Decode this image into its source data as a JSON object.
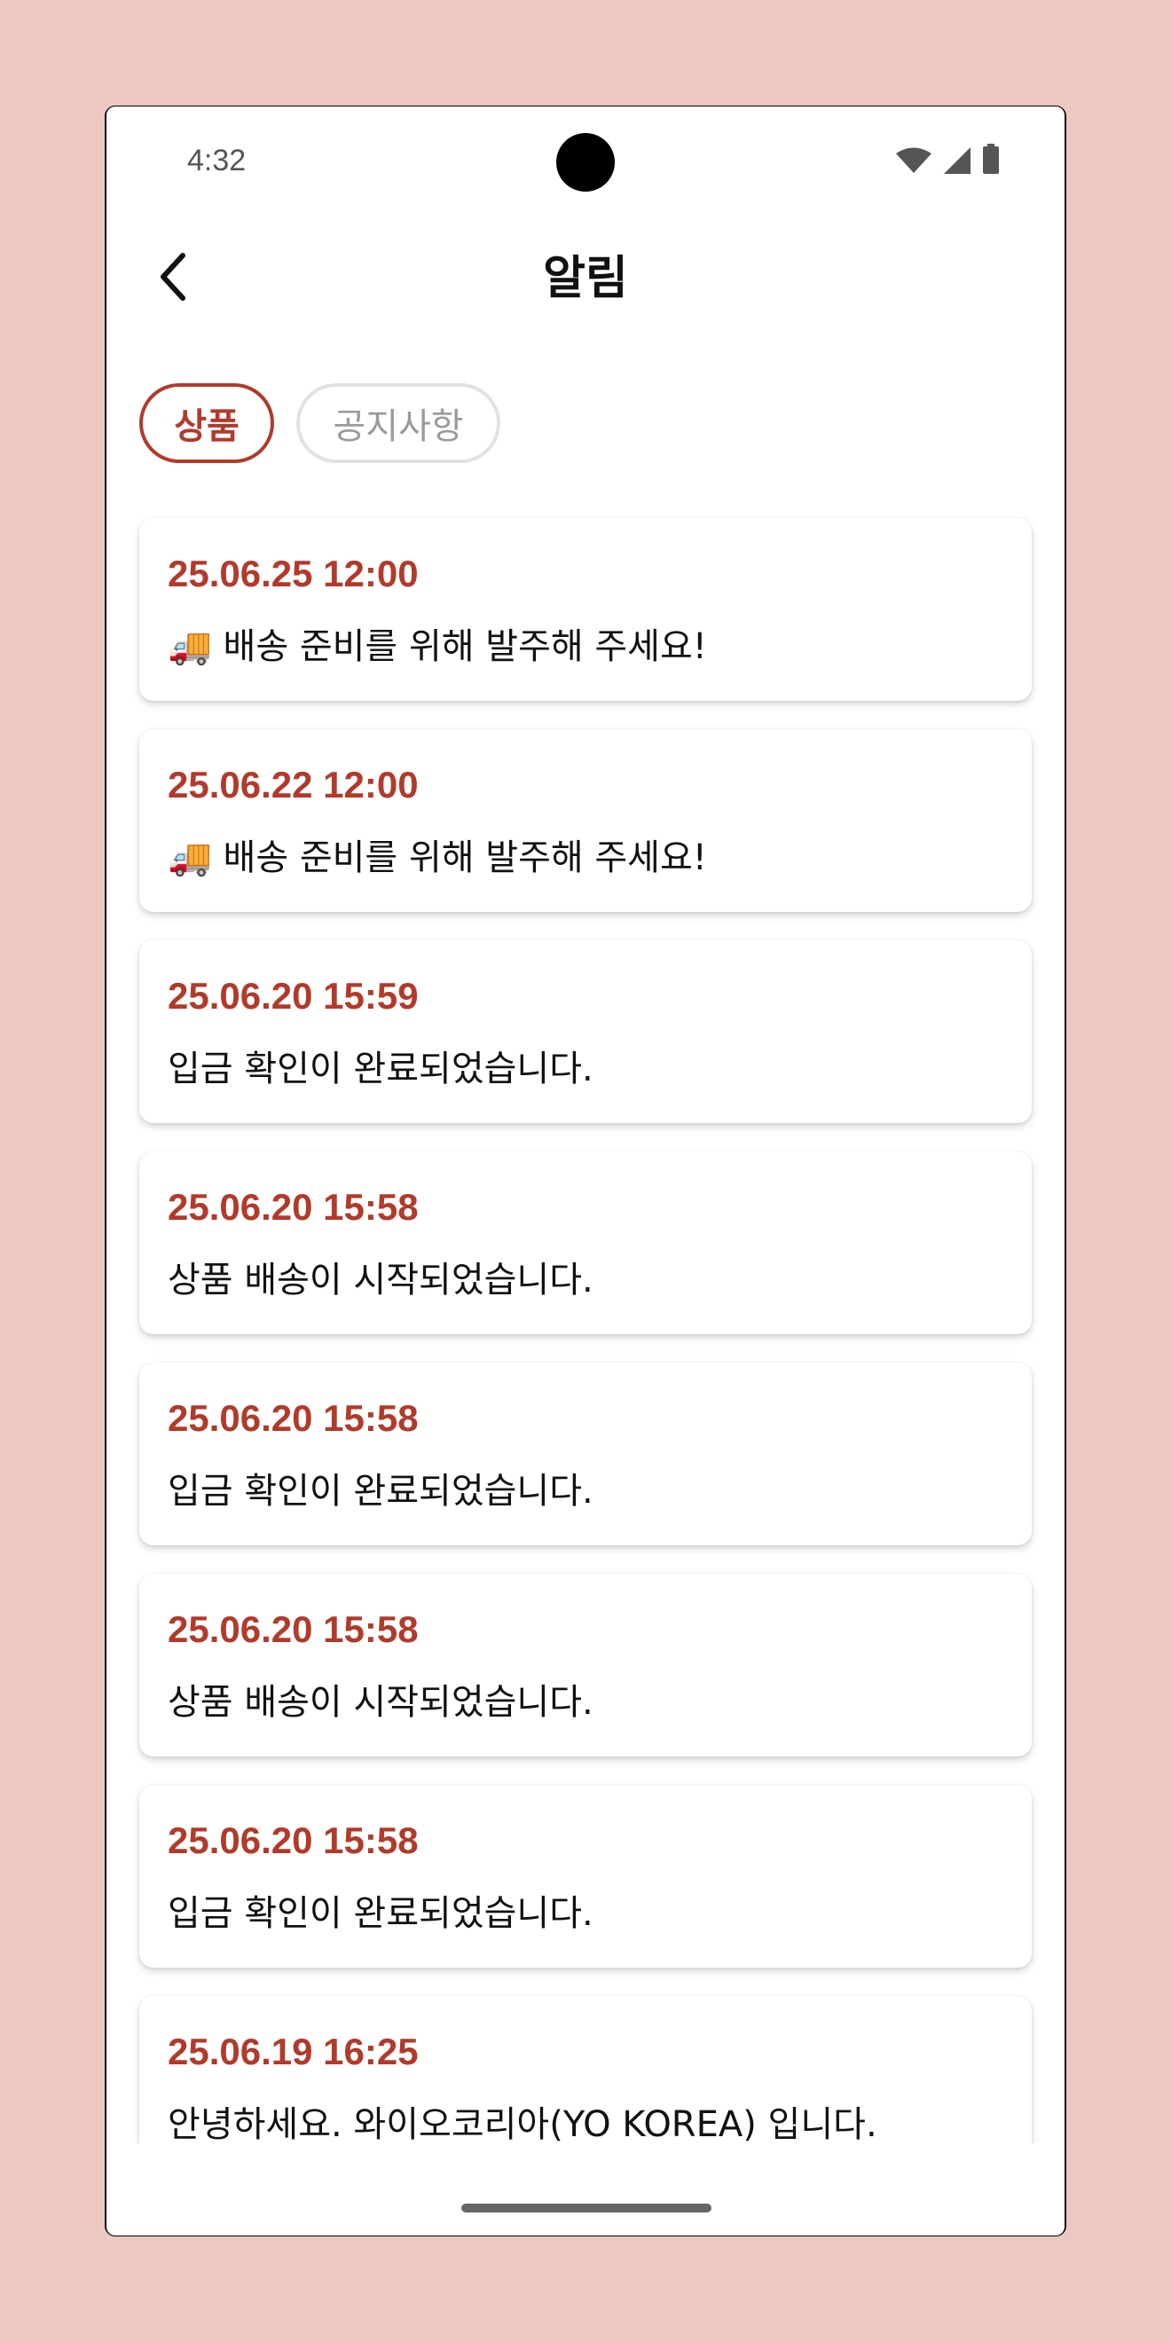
{
  "status_bar": {
    "time": "4:32"
  },
  "header": {
    "title": "알림"
  },
  "tabs": [
    {
      "label": "상품",
      "active": true
    },
    {
      "label": "공지사항",
      "active": false
    }
  ],
  "notifications": [
    {
      "date": "25.06.25 12:00",
      "message": "🚚 배송 준비를 위해 발주해 주세요!"
    },
    {
      "date": "25.06.22 12:00",
      "message": "🚚 배송 준비를 위해 발주해 주세요!"
    },
    {
      "date": "25.06.20 15:59",
      "message": "입금 확인이 완료되었습니다."
    },
    {
      "date": "25.06.20 15:58",
      "message": "상품 배송이 시작되었습니다."
    },
    {
      "date": "25.06.20 15:58",
      "message": "입금 확인이 완료되었습니다."
    },
    {
      "date": "25.06.20 15:58",
      "message": "상품 배송이 시작되었습니다."
    },
    {
      "date": "25.06.20 15:58",
      "message": "입금 확인이 완료되었습니다."
    },
    {
      "date": "25.06.19 16:25",
      "message": "안녕하세요. 와이오코리아(YO KOREA) 입니다."
    }
  ],
  "colors": {
    "accent": "#b23a2a",
    "background": "#ecc8c1",
    "inactive_tab_border": "#e2e2e2"
  },
  "icons": {
    "back": "chevron-left-icon",
    "wifi": "wifi-icon",
    "signal": "cell-signal-icon",
    "battery": "battery-icon"
  }
}
